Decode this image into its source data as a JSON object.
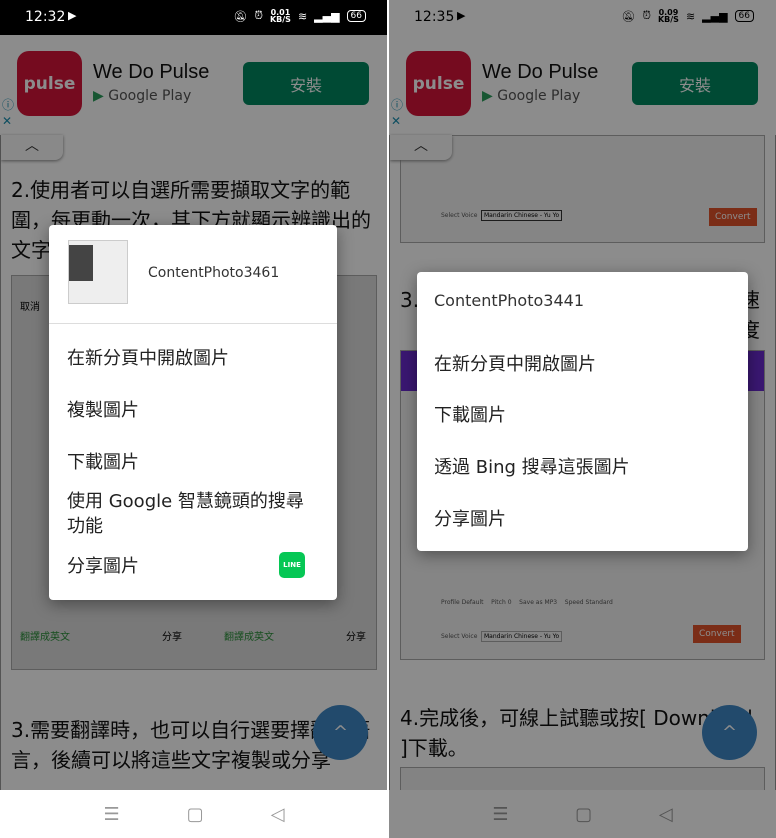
{
  "left": {
    "status": {
      "time": "12:32",
      "speed": "0.01",
      "speed_unit": "KB/S",
      "battery": "66"
    },
    "ad": {
      "logo": "pulse",
      "title": "We Do Pulse",
      "store": "Google Play",
      "install": "安裝"
    },
    "content": {
      "heading2": "2.使用者可以自選所需要擷取文字的範圍，每更動一次，其下方就顯示辨識出的文字",
      "heading3": "3.需要翻譯時，也可以自行選要擇翻譯語言，後續可以將這些文字複製或分享",
      "translate": "翻譯成英文",
      "share": "分享",
      "cancel": "取消"
    },
    "dialog": {
      "title": "ContentPhoto3461",
      "items": [
        "在新分頁中開啟圖片",
        "複製圖片",
        "下載圖片",
        "使用 Google 智慧鏡頭的搜尋功能",
        "分享圖片"
      ],
      "line_label": "LINE"
    }
  },
  "right": {
    "status": {
      "time": "12:35",
      "speed": "0.09",
      "speed_unit": "KB/S",
      "battery": "66"
    },
    "ad": {
      "logo": "pulse",
      "title": "We Do Pulse",
      "store": "Google Play",
      "install": "安裝"
    },
    "content": {
      "heading3": "3.",
      "heading3_end": "速度",
      "heading4": "4.完成後，可線上試聽或按[ Download ]下載。",
      "convert": "Convert",
      "select_voice": "Select Voice",
      "voice": "Mandarin Chinese - Yu Yo",
      "profile": "Profile",
      "profile_val": "Default",
      "pitch": "Pitch",
      "pitch_val": "0",
      "save_as": "Save as",
      "save_val": "MP3",
      "speed": "Speed",
      "speed_val": "Standard"
    },
    "dialog": {
      "title": "ContentPhoto3441",
      "items": [
        "在新分頁中開啟圖片",
        "下載圖片",
        "透過 Bing 搜尋這張圖片",
        "分享圖片"
      ]
    }
  },
  "colors": {
    "install": "#01875f",
    "line": "#06c755",
    "fab": "#3f88c5",
    "convert": "#e0522a",
    "pulse": "#d5153a"
  }
}
